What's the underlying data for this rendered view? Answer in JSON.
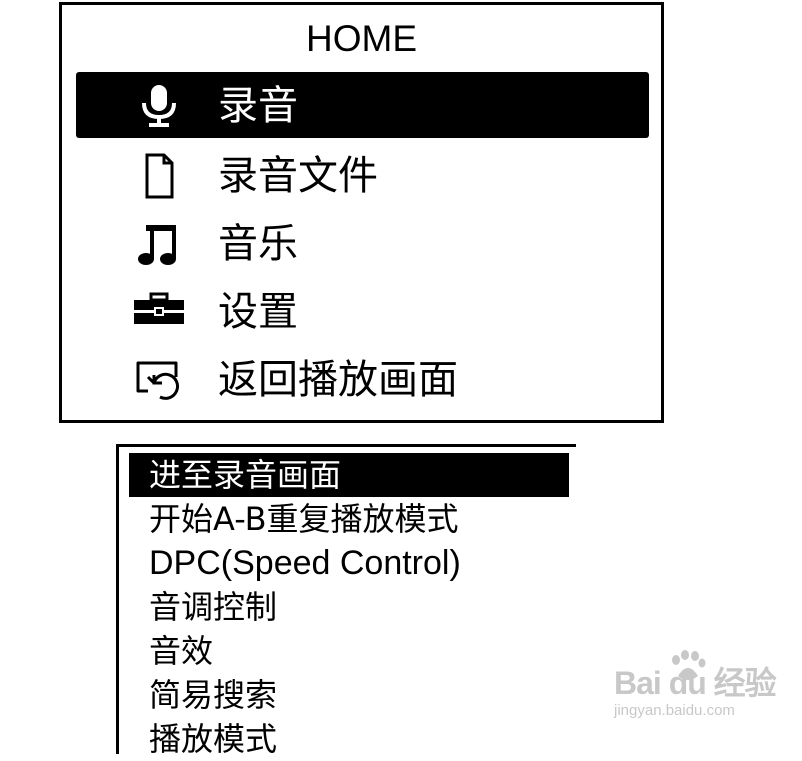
{
  "home_menu": {
    "title": "HOME",
    "items": [
      {
        "label": "录音",
        "icon": "microphone-icon",
        "selected": true
      },
      {
        "label": "录音文件",
        "icon": "file-icon",
        "selected": false
      },
      {
        "label": "音乐",
        "icon": "music-note-icon",
        "selected": false
      },
      {
        "label": "设置",
        "icon": "toolbox-icon",
        "selected": false
      },
      {
        "label": "返回播放画面",
        "icon": "return-icon",
        "selected": false
      }
    ]
  },
  "option_menu": {
    "items": [
      {
        "label": "进至录音画面",
        "selected": true
      },
      {
        "label": "开始A-B重复播放模式",
        "selected": false
      },
      {
        "label": "DPC(Speed Control)",
        "selected": false
      },
      {
        "label": "音调控制",
        "selected": false
      },
      {
        "label": "音效",
        "selected": false
      },
      {
        "label": "简易搜索",
        "selected": false
      },
      {
        "label": "播放模式",
        "selected": false
      }
    ]
  },
  "watermark": {
    "brand": "Bai du 经验",
    "url": "jingyan.baidu.com"
  },
  "colors": {
    "foreground": "#000000",
    "background": "#ffffff",
    "watermark": "#c8c8c8"
  }
}
